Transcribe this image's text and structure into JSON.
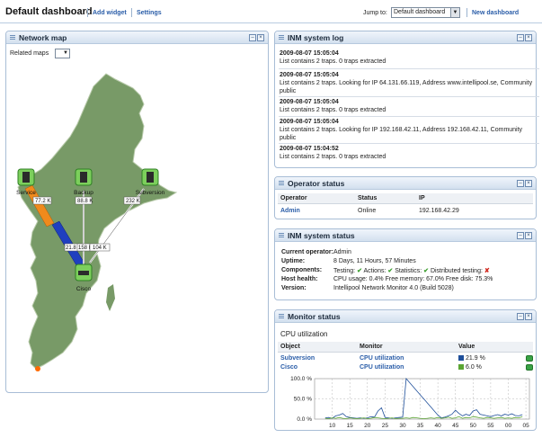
{
  "header": {
    "title": "Default dashboard",
    "add_widget": "Add widget",
    "settings": "Settings",
    "jump_label": "Jump to:",
    "jump_value": "Default dashboard",
    "new_dashboard": "New dashboard"
  },
  "network_map": {
    "title": "Network map",
    "related_label": "Related maps",
    "nodes": [
      "Service",
      "Backup",
      "Subversion",
      "Cisco"
    ],
    "traffic": [
      "77.2 K",
      "88.8 K",
      "232 K",
      "21.8 K",
      "158 K",
      "104 K"
    ]
  },
  "system_log": {
    "title": "INM system log",
    "entries": [
      {
        "time": "2009-08-07 15:05:04",
        "text": "List contains 2 traps. 0 traps extracted"
      },
      {
        "time": "2009-08-07 15:05:04",
        "text": "List contains 2 traps. Looking for IP 64.131.66.119, Address www.intellipool.se, Community public"
      },
      {
        "time": "2009-08-07 15:05:04",
        "text": "List contains 2 traps. 0 traps extracted"
      },
      {
        "time": "2009-08-07 15:05:04",
        "text": "List contains 2 traps. Looking for IP 192.168.42.11, Address 192.168.42.11, Community public"
      },
      {
        "time": "2009-08-07 15:04:52",
        "text": "List contains 2 traps. 0 traps extracted"
      }
    ]
  },
  "operator_status": {
    "title": "Operator status",
    "columns": [
      "Operator",
      "Status",
      "IP"
    ],
    "rows": [
      {
        "operator": "Admin",
        "status": "Online",
        "ip": "192.168.42.29"
      }
    ]
  },
  "inm_status": {
    "title": "INM system status",
    "current_operator_label": "Current operator:",
    "current_operator": "Admin",
    "uptime_label": "Uptime:",
    "uptime": "8 Days, 11 Hours, 57 Minutes",
    "components_label": "Components:",
    "components": [
      "Testing:",
      "Actions:",
      "Statistics:",
      "Distributed testing:"
    ],
    "host_health_label": "Host health:",
    "host_health": "CPU usage: 0.4% Free memory: 67.0% Free disk: 75.3%",
    "version_label": "Version:",
    "version": "Intellipool Network Monitor 4.0 (Build 5028)"
  },
  "monitor_status": {
    "title": "Monitor status",
    "subtitle": "CPU utilization",
    "columns": [
      "Object",
      "Monitor",
      "Value"
    ],
    "rows": [
      {
        "object": "Subversion",
        "monitor": "CPU utilization",
        "value": "21.9 %",
        "color": "#1f4f9a"
      },
      {
        "object": "Cisco",
        "monitor": "CPU utilization",
        "value": "6.0 %",
        "color": "#5aa532"
      }
    ]
  },
  "chart_data": {
    "type": "line",
    "x": [
      8,
      9,
      10,
      11,
      12,
      13,
      14,
      15,
      16,
      17,
      18,
      19,
      20,
      21,
      22,
      23,
      24,
      25,
      26,
      27,
      28,
      29,
      30,
      31,
      32,
      33,
      34,
      35,
      36,
      37,
      38,
      39,
      40,
      41,
      42,
      43,
      44,
      45,
      46,
      47,
      48,
      49,
      50,
      51,
      52,
      53,
      54,
      55,
      56,
      57,
      58,
      59,
      60,
      61,
      62,
      63,
      64
    ],
    "series": [
      {
        "name": "Subversion",
        "color": "#1f4f9a",
        "values": [
          3,
          4,
          2,
          8,
          10,
          14,
          6,
          4,
          3,
          2,
          3,
          2,
          3,
          6,
          5,
          20,
          28,
          4,
          3,
          2,
          3,
          4,
          5,
          100,
          90,
          80,
          70,
          60,
          50,
          40,
          30,
          20,
          10,
          3,
          5,
          8,
          12,
          22,
          14,
          8,
          12,
          9,
          20,
          23,
          12,
          10,
          8,
          6,
          9,
          11,
          8,
          12,
          10,
          13,
          9,
          8,
          11
        ]
      },
      {
        "name": "Cisco",
        "color": "#5aa532",
        "values": [
          2,
          1,
          3,
          2,
          4,
          2,
          1,
          3,
          2,
          1,
          2,
          3,
          1,
          2,
          4,
          3,
          2,
          1,
          2,
          3,
          1,
          2,
          2,
          3,
          2,
          4,
          3,
          2,
          1,
          2,
          3,
          2,
          4,
          2,
          3,
          5,
          2,
          3,
          6,
          2,
          4,
          3,
          6,
          5,
          3,
          2,
          4,
          3,
          2,
          3,
          4,
          2,
          3,
          2,
          4,
          3,
          6
        ]
      }
    ],
    "xticks": [
      "10",
      "15",
      "20",
      "25",
      "30",
      "35",
      "40",
      "45",
      "50",
      "55",
      "00",
      "05"
    ],
    "xtick_positions": [
      10,
      15,
      20,
      25,
      30,
      35,
      40,
      45,
      50,
      55,
      60,
      65
    ],
    "yticks": [
      "0.0 %",
      "50.0 %",
      "100.0 %"
    ],
    "ylim": [
      0,
      100
    ],
    "xlim": [
      5,
      66
    ]
  }
}
